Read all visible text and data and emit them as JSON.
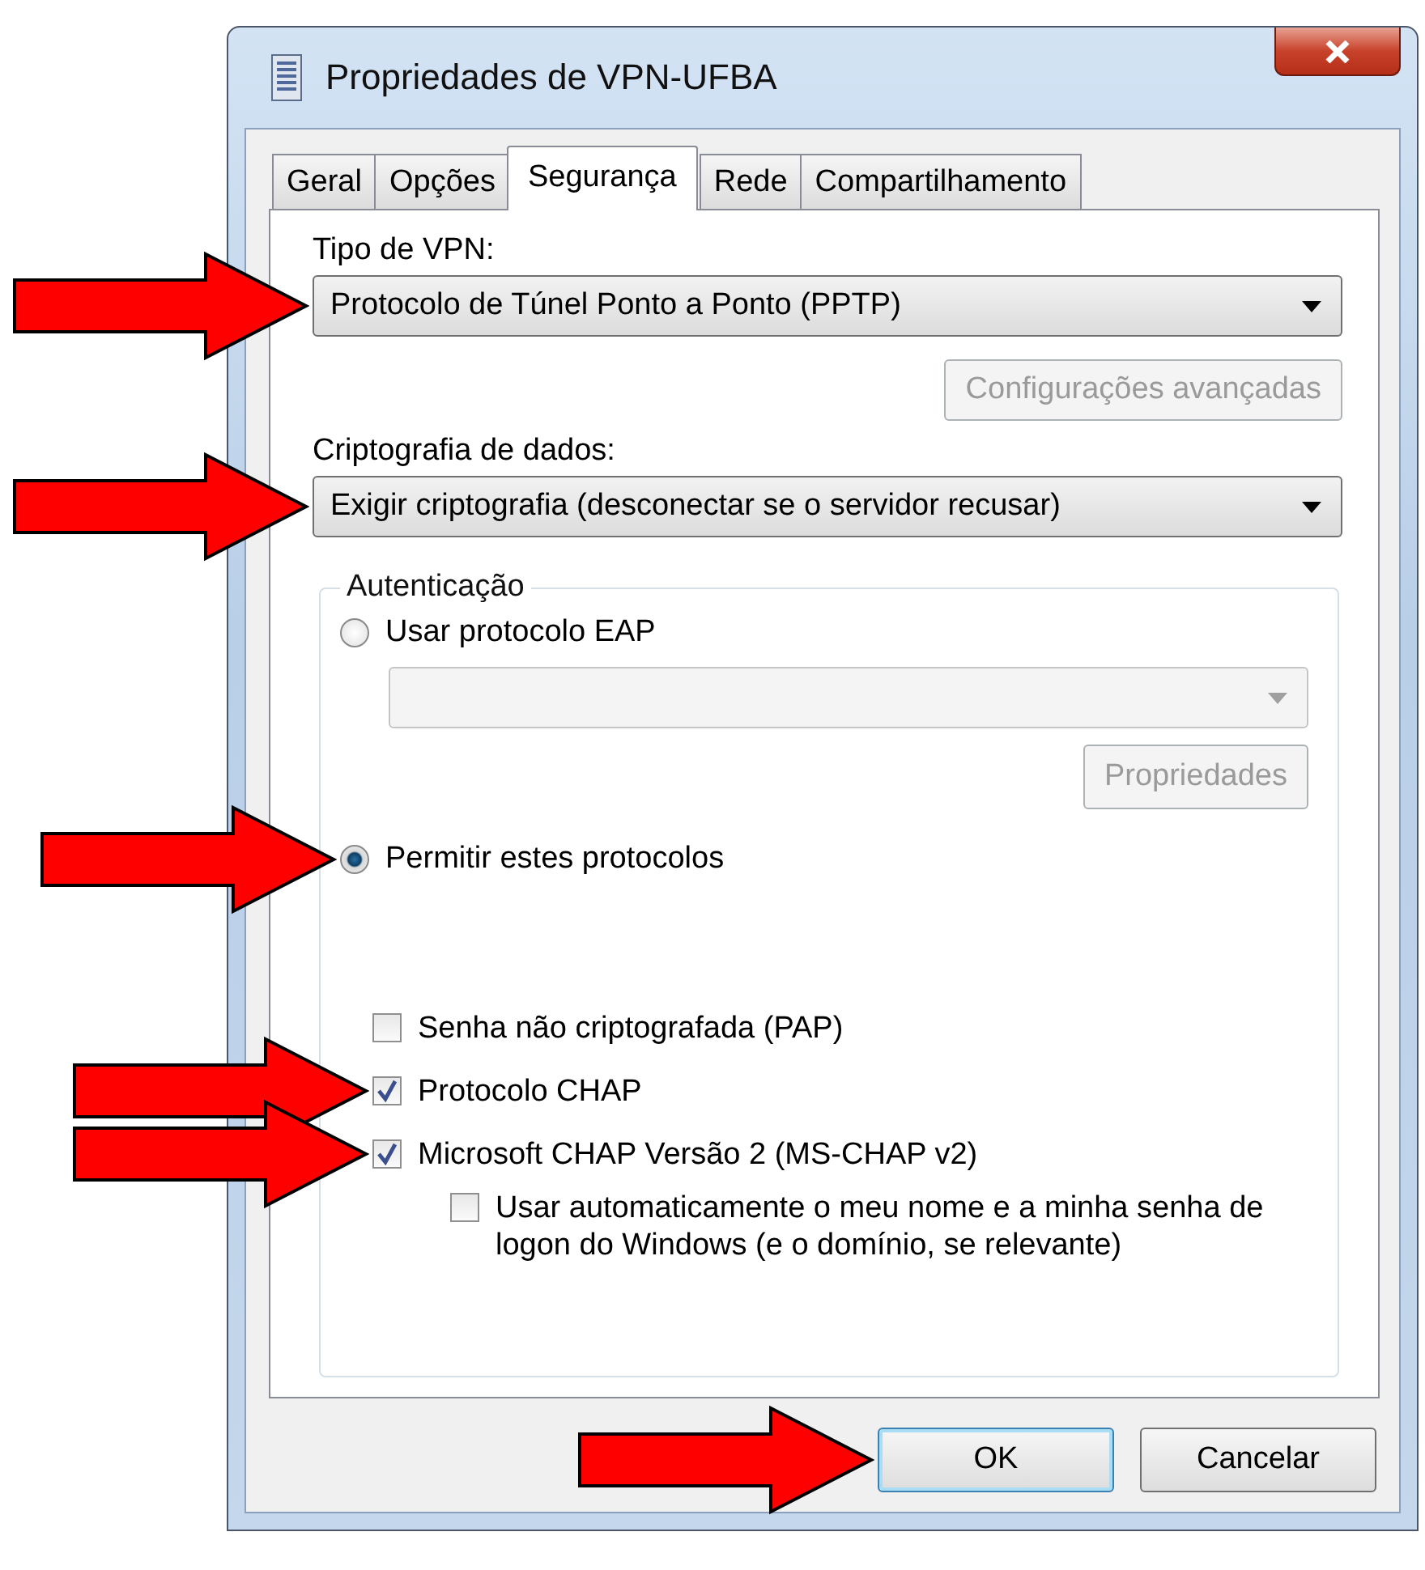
{
  "window": {
    "title": "Propriedades de VPN-UFBA"
  },
  "tabs": [
    {
      "label": "Geral",
      "selected": false
    },
    {
      "label": "Opções",
      "selected": false
    },
    {
      "label": "Segurança",
      "selected": true
    },
    {
      "label": "Rede",
      "selected": false
    },
    {
      "label": "Compartilhamento",
      "selected": false
    }
  ],
  "vpn_type": {
    "label": "Tipo de VPN:",
    "value": "Protocolo de Túnel Ponto a Ponto (PPTP)",
    "marked": true
  },
  "advanced_button": {
    "label": "Configurações avançadas",
    "disabled": true
  },
  "encryption": {
    "label": "Criptografia de dados:",
    "value": "Exigir criptografia (desconectar se o servidor recusar)",
    "marked": true
  },
  "authentication": {
    "title": "Autenticação",
    "eap_option": {
      "label": "Usar protocolo EAP",
      "selected": false,
      "marked": false
    },
    "eap_dropdown": {
      "disabled": true
    },
    "properties_button": {
      "label": "Propriedades",
      "disabled": true
    },
    "protocols_option": {
      "label": "Permitir estes protocolos",
      "selected": true,
      "marked": true
    },
    "protocols": [
      {
        "label": "Senha não criptografada (PAP)",
        "checked": false,
        "marked": false
      },
      {
        "label": "Protocolo CHAP",
        "checked": true,
        "marked": true
      },
      {
        "label": "Microsoft CHAP Versão 2 (MS-CHAP v2)",
        "checked": true,
        "marked": true,
        "children": [
          {
            "label": "Usar automaticamente o meu nome e a minha senha de logon do Windows (e o domínio, se relevante)",
            "checked": false,
            "marked": false
          }
        ]
      }
    ]
  },
  "buttons": [
    {
      "label": "OK",
      "default": true,
      "marked": true
    },
    {
      "label": "Cancelar",
      "default": false,
      "marked": false
    }
  ]
}
